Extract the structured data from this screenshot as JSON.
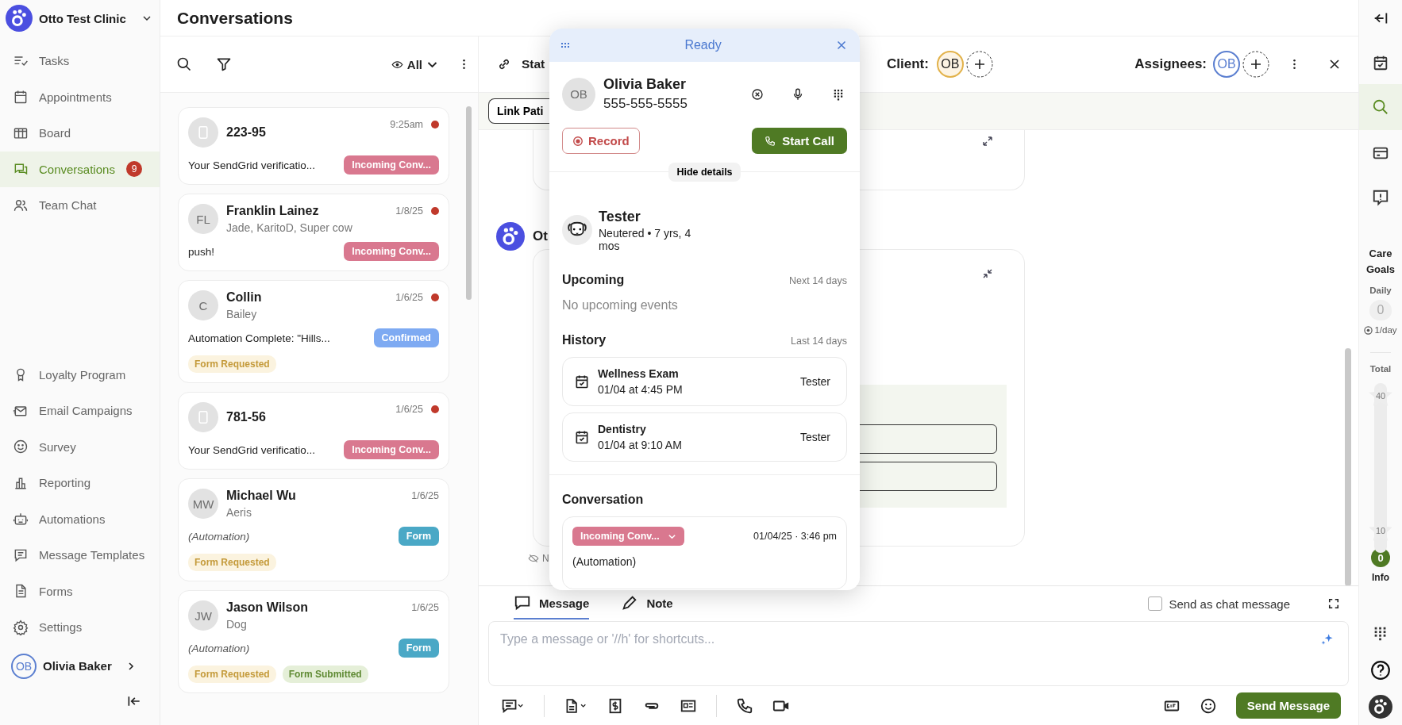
{
  "sidebar": {
    "clinic": "Otto Test Clinic",
    "nav_primary": [
      {
        "label": "Tasks",
        "selected": false
      },
      {
        "label": "Appointments",
        "selected": false
      },
      {
        "label": "Board",
        "selected": false
      },
      {
        "label": "Conversations",
        "selected": true,
        "badge": "9"
      },
      {
        "label": "Team Chat",
        "selected": false
      }
    ],
    "nav_secondary": [
      {
        "label": "Loyalty Program",
        "selected": false
      },
      {
        "label": "Email Campaigns",
        "selected": false
      },
      {
        "label": "Survey",
        "selected": false
      },
      {
        "label": "Reporting",
        "selected": false
      },
      {
        "label": "Automations",
        "selected": false
      },
      {
        "label": "Message Templates",
        "selected": false
      },
      {
        "label": "Forms",
        "selected": false
      },
      {
        "label": "Settings",
        "selected": false
      }
    ],
    "user": {
      "initials": "OB",
      "name": "Olivia Baker"
    }
  },
  "header": {
    "title": "Conversations"
  },
  "list": {
    "filter": "All",
    "conversations": [
      {
        "name": "223-95",
        "time": "9:25am",
        "unread": true,
        "preview": "Your SendGrid verificatio...",
        "automated": false,
        "tag": {
          "label": "Incoming Conv...",
          "color": "#d9788f"
        }
      },
      {
        "initials": "FL",
        "name": "Franklin Lainez",
        "subtitle": "Jade, KaritoD, Super cow",
        "time": "1/8/25",
        "unread": true,
        "preview": "push!",
        "automated": false,
        "tag": {
          "label": "Incoming Conv...",
          "color": "#d9788f"
        }
      },
      {
        "initials": "C",
        "name": "Collin",
        "subtitle": "Bailey",
        "time": "1/6/25",
        "unread": true,
        "preview": "Automation Complete: \"Hills...",
        "automated": false,
        "tag": {
          "label": "Confirmed",
          "color": "#7eaaf2"
        },
        "chips": [
          {
            "label": "Form Requested",
            "kind": "requested"
          }
        ]
      },
      {
        "name": "781-56",
        "time": "1/6/25",
        "unread": true,
        "preview": "Your SendGrid verificatio...",
        "automated": false,
        "tag": {
          "label": "Incoming Conv...",
          "color": "#d9788f"
        }
      },
      {
        "initials": "MW",
        "name": "Michael Wu",
        "subtitle": "Aeris",
        "time": "1/6/25",
        "unread": false,
        "preview": "(Automation)",
        "automated": true,
        "tag": {
          "label": "Form",
          "color": "#4aa8c6"
        },
        "chips": [
          {
            "label": "Form Requested",
            "kind": "requested"
          }
        ]
      },
      {
        "initials": "JW",
        "name": "Jason Wilson",
        "subtitle": "Dog",
        "time": "1/6/25",
        "unread": false,
        "preview": "(Automation)",
        "automated": true,
        "tag": {
          "label": "Form",
          "color": "#4aa8c6"
        },
        "chips": [
          {
            "label": "Form Requested",
            "kind": "requested"
          },
          {
            "label": "Form Submitted",
            "kind": "submitted"
          }
        ]
      }
    ]
  },
  "thread": {
    "status_fragment": "Stat",
    "client_label": "Client:",
    "client_initials": "OB",
    "assignees_label": "Assignees:",
    "assignee_initials": "OB",
    "link_button": "Link Pati",
    "sender_fragment": "Ot",
    "note_fragment": "N"
  },
  "composer": {
    "tabs": [
      {
        "label": "Message",
        "selected": true
      },
      {
        "label": "Note",
        "selected": false
      }
    ],
    "send_as_chat": {
      "label": "Send as chat message",
      "checked": false
    },
    "placeholder": "Type a message or '//h' for shortcuts...",
    "send_button": "Send Message"
  },
  "popup": {
    "status": "Ready",
    "contact": {
      "initials": "OB",
      "name": "Olivia Baker",
      "phone": "555-555-5555"
    },
    "record_button": "Record",
    "call_button": "Start Call",
    "hide_details": "Hide details",
    "pet": {
      "name": "Tester",
      "details": "Neutered • 7 yrs, 4 mos"
    },
    "upcoming": {
      "title": "Upcoming",
      "range": "Next 14 days",
      "empty": "No upcoming events"
    },
    "history": {
      "title": "History",
      "range": "Last 14 days",
      "items": [
        {
          "title": "Wellness Exam",
          "when": "01/04 at 4:45 PM",
          "patient": "Tester"
        },
        {
          "title": "Dentistry",
          "when": "01/04 at 9:10 AM",
          "patient": "Tester"
        }
      ]
    },
    "conversation": {
      "title": "Conversation",
      "tag": {
        "label": "Incoming Conv...",
        "color": "#d9788f"
      },
      "timestamp": "01/04/25 · 3:46 pm",
      "text": "(Automation)"
    }
  },
  "rail": {
    "care_goals": "Care Goals",
    "daily_label": "Daily",
    "daily_value": "0",
    "daily_target": "1/day",
    "total_label": "Total",
    "milestones": [
      "40",
      "10"
    ],
    "total_value": "0",
    "info": "Info"
  }
}
